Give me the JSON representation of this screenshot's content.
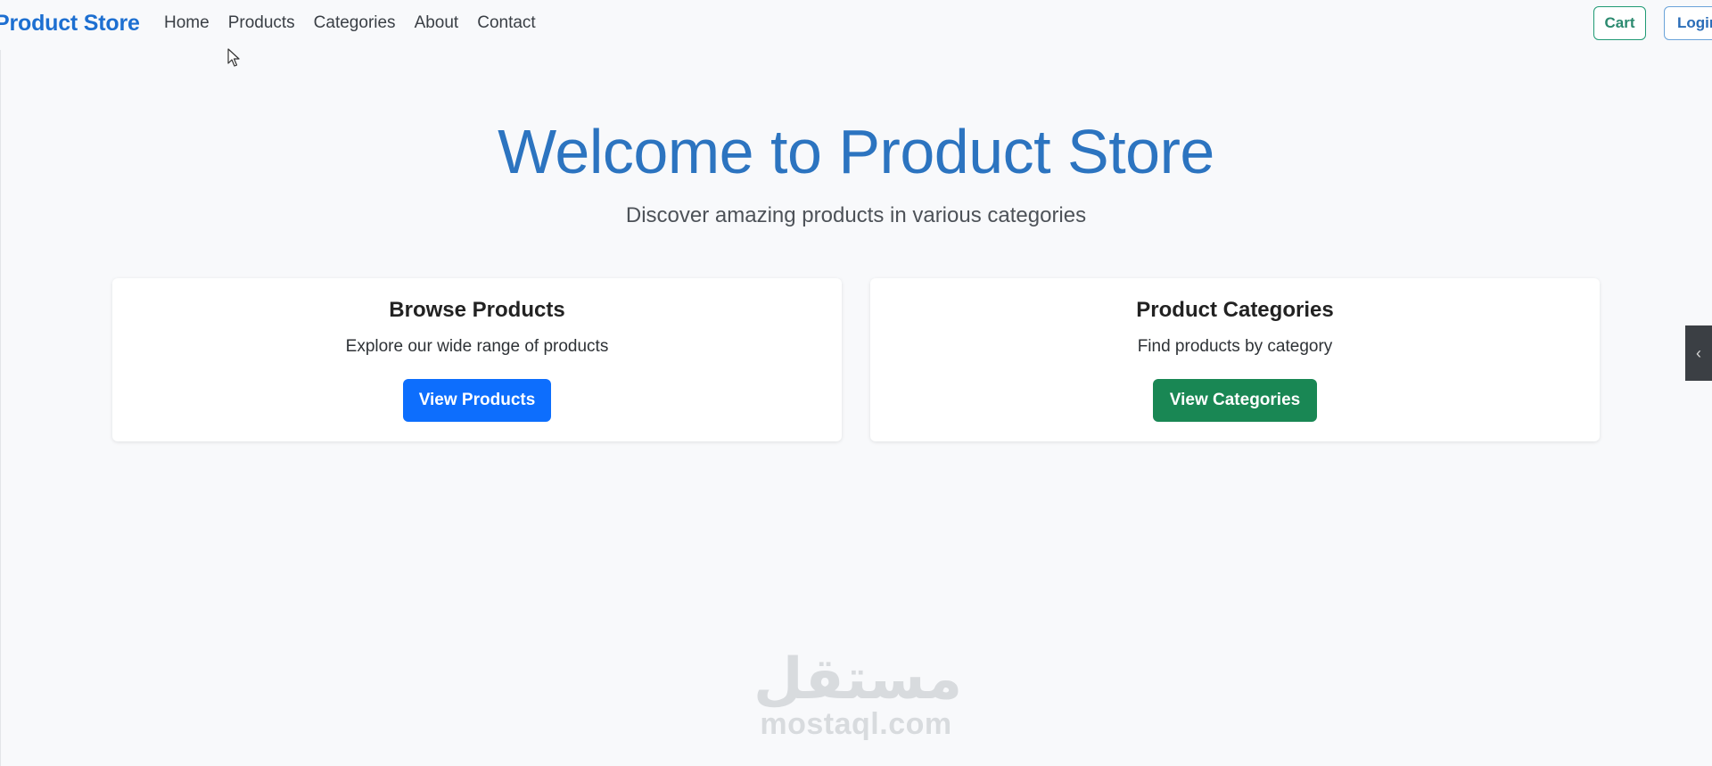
{
  "navbar": {
    "brand": "Product Store",
    "links": [
      "Home",
      "Products",
      "Categories",
      "About",
      "Contact"
    ],
    "cart_label": "Cart",
    "login_label": "Login"
  },
  "hero": {
    "title": "Welcome to Product Store",
    "subtitle": "Discover amazing products in various categories"
  },
  "cards": [
    {
      "title": "Browse Products",
      "text": "Explore our wide range of products",
      "button_label": "View Products"
    },
    {
      "title": "Product Categories",
      "text": "Find products by category",
      "button_label": "View Categories"
    }
  ],
  "side_tab": {
    "icon": "chevron-left-icon"
  },
  "watermark": {
    "arabic": "مستقل",
    "latin": "mostaql.com"
  },
  "colors": {
    "brand": "#1d6fd1",
    "primary": "#0d6efd",
    "success": "#198754",
    "hero_title": "#2c74c0",
    "background": "#f8f9fb"
  }
}
